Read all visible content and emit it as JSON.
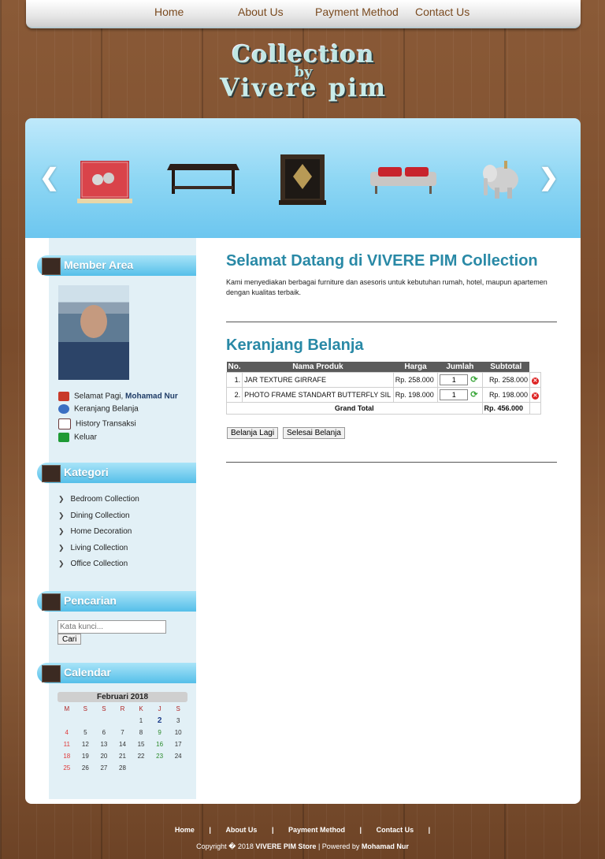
{
  "nav": {
    "items": [
      "Home",
      "About Us",
      "Payment Method",
      "Contact Us"
    ]
  },
  "logo": {
    "line1": "Collection",
    "line2": "by",
    "line3": "Vivere pim"
  },
  "sidebar": {
    "member_title": "Member Area",
    "greeting_prefix": "Selamat Pagi, ",
    "user_name": "Mohamad Nur",
    "member_items": [
      "Keranjang Belanja",
      "History Transaksi",
      "Keluar"
    ],
    "kategori_title": "Kategori",
    "categories": [
      "Bedroom Collection",
      "Dining Collection",
      "Home Decoration",
      "Living Collection",
      "Office Collection"
    ],
    "pencarian_title": "Pencarian",
    "search_placeholder": "Kata kunci...",
    "search_button": "Cari",
    "calendar_title": "Calendar",
    "calendar": {
      "month": "Februari 2018",
      "days": [
        "M",
        "S",
        "S",
        "R",
        "K",
        "J",
        "S"
      ],
      "rows": [
        [
          "",
          "",
          "",
          "",
          "1",
          "2",
          "3"
        ],
        [
          "4",
          "5",
          "6",
          "7",
          "8",
          "9",
          "10"
        ],
        [
          "11",
          "12",
          "13",
          "14",
          "15",
          "16",
          "17"
        ],
        [
          "18",
          "19",
          "20",
          "21",
          "22",
          "23",
          "24"
        ],
        [
          "25",
          "26",
          "27",
          "28",
          "",
          "",
          ""
        ]
      ]
    }
  },
  "main": {
    "welcome_title": "Selamat Datang di VIVERE PIM Collection",
    "welcome_desc": "Kami menyediakan berbagai furniture dan asesoris untuk kebutuhan rumah, hotel, maupun apartemen dengan kualitas terbaik.",
    "cart_title": "Keranjang Belanja",
    "cart_headers": [
      "No.",
      "Nama Produk",
      "Harga",
      "Jumlah",
      "Subtotal"
    ],
    "cart_rows": [
      {
        "no": "1.",
        "name": "JAR TEXTURE GIRRAFE",
        "price": "Rp. 258.000",
        "qty": "1",
        "subtotal": "Rp. 258.000"
      },
      {
        "no": "2.",
        "name": "PHOTO FRAME STANDART BUTTERFLY SIL",
        "price": "Rp. 198.000",
        "qty": "1",
        "subtotal": "Rp. 198.000"
      }
    ],
    "grand_total_label": "Grand Total",
    "grand_total_value": "Rp. 456.000",
    "btn_continue": "Belanja Lagi",
    "btn_finish": "Selesai Belanja"
  },
  "footer": {
    "links": [
      "Home",
      "About Us",
      "Payment Method",
      "Contact Us"
    ],
    "separator": "|",
    "copyright_prefix": "Copyright � 2018 ",
    "store": "VIVERE PIM Store",
    "powered": " | Powered by ",
    "author": "Mohamad Nur"
  }
}
